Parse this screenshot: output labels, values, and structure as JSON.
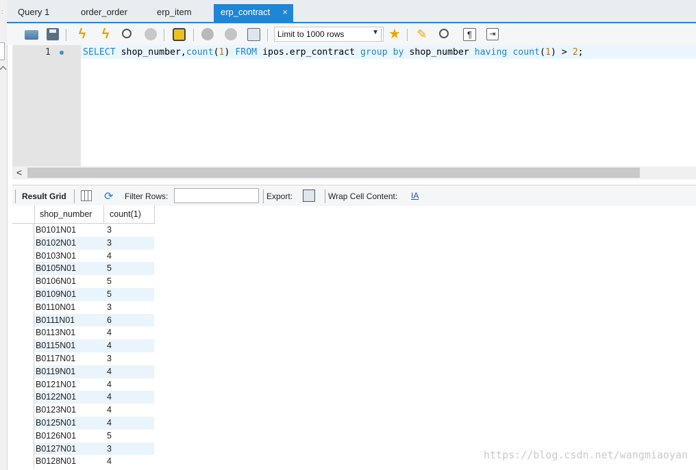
{
  "tabs": [
    {
      "label": "Query 1",
      "active": false
    },
    {
      "label": "order_order",
      "active": false
    },
    {
      "label": "erp_item",
      "active": false
    },
    {
      "label": "erp_contract",
      "active": true
    }
  ],
  "tab_close_glyph": "×",
  "toolbar": {
    "limit_label": "Limit to 1000 rows",
    "icons": [
      "open-folder-icon",
      "save-icon",
      "execute-icon",
      "execute-current-icon",
      "explain-icon",
      "stop-icon",
      "toggle-autocommit-icon",
      "commit-icon",
      "rollback-icon",
      "toggle-error-icon",
      "beautify-icon",
      "find-icon",
      "invisible-chars-icon",
      "wrap-text-icon"
    ]
  },
  "editor": {
    "line_number": "1",
    "sql_tokens": [
      {
        "t": "SELECT",
        "k": "kw"
      },
      {
        "t": " shop_number,",
        "k": "plain"
      },
      {
        "t": "count",
        "k": "kw"
      },
      {
        "t": "(",
        "k": "plain"
      },
      {
        "t": "1",
        "k": "num"
      },
      {
        "t": ") ",
        "k": "plain"
      },
      {
        "t": "FROM",
        "k": "kw"
      },
      {
        "t": " ipos.erp_contract ",
        "k": "plain"
      },
      {
        "t": "group by",
        "k": "kw"
      },
      {
        "t": " shop_number ",
        "k": "plain"
      },
      {
        "t": "having",
        "k": "kw"
      },
      {
        "t": " ",
        "k": "plain"
      },
      {
        "t": "count",
        "k": "kw"
      },
      {
        "t": "(",
        "k": "plain"
      },
      {
        "t": "1",
        "k": "num"
      },
      {
        "t": ") > ",
        "k": "plain"
      },
      {
        "t": "2",
        "k": "num"
      },
      {
        "t": ";",
        "k": "plain"
      }
    ]
  },
  "hscroll": {
    "left_arrow": "<"
  },
  "result_toolbar": {
    "result_grid_label": "Result Grid",
    "filter_label": "Filter Rows:",
    "filter_value": "",
    "export_label": "Export:",
    "wrap_label": "Wrap Cell Content:",
    "wrap_icon_glyph": "IA"
  },
  "grid": {
    "columns": [
      "shop_number",
      "count(1)"
    ],
    "rows": [
      [
        "B0101N01",
        "3"
      ],
      [
        "B0102N01",
        "3"
      ],
      [
        "B0103N01",
        "4"
      ],
      [
        "B0105N01",
        "5"
      ],
      [
        "B0106N01",
        "5"
      ],
      [
        "B0109N01",
        "5"
      ],
      [
        "B0110N01",
        "3"
      ],
      [
        "B0111N01",
        "6"
      ],
      [
        "B0113N01",
        "4"
      ],
      [
        "B0115N01",
        "4"
      ],
      [
        "B0117N01",
        "3"
      ],
      [
        "B0119N01",
        "4"
      ],
      [
        "B0121N01",
        "4"
      ],
      [
        "B0122N01",
        "4"
      ],
      [
        "B0123N01",
        "4"
      ],
      [
        "B0125N01",
        "4"
      ],
      [
        "B0126N01",
        "5"
      ],
      [
        "B0127N01",
        "3"
      ],
      [
        "B0128N01",
        "4"
      ]
    ]
  },
  "watermark": "https://blog.csdn.net/wangmiaoyan"
}
